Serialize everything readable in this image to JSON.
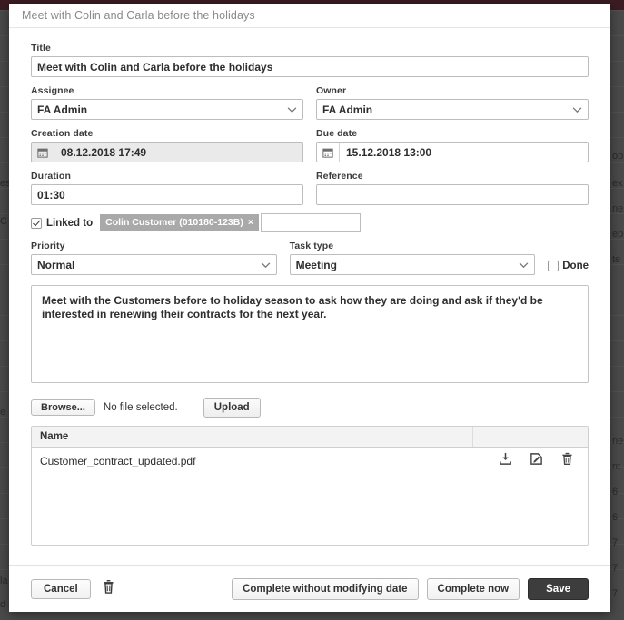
{
  "window": {
    "title": "Meet with Colin and Carla before the holidays"
  },
  "form": {
    "title_label": "Title",
    "title_value": "Meet with Colin and Carla before the holidays",
    "assignee_label": "Assignee",
    "assignee_value": "FA Admin",
    "owner_label": "Owner",
    "owner_value": "FA Admin",
    "creation_date_label": "Creation date",
    "creation_date_value": "08.12.2018 17:49",
    "due_date_label": "Due date",
    "due_date_value": "15.12.2018 13:00",
    "duration_label": "Duration",
    "duration_value": "01:30",
    "reference_label": "Reference",
    "reference_value": "",
    "linked_to_label": "Linked to",
    "linked_to_checked": true,
    "linked_token": "Colin Customer (010180-123B)",
    "linked_token_remove": "×",
    "linked_input_value": "",
    "priority_label": "Priority",
    "priority_value": "Normal",
    "task_type_label": "Task type",
    "task_type_value": "Meeting",
    "done_label": "Done",
    "done_checked": false,
    "description_value": "Meet with the Customers before to holiday season to ask how they are doing and ask if they'd be interested in renewing their contracts for the next year."
  },
  "attachments": {
    "browse_label": "Browse...",
    "no_file_text": "No file selected.",
    "upload_label": "Upload",
    "column_name": "Name",
    "rows": [
      {
        "name": "Customer_contract_updated.pdf",
        "download_icon": "download-icon",
        "edit_icon": "edit-icon",
        "delete_icon": "trash-icon"
      }
    ]
  },
  "footer": {
    "cancel_label": "Cancel",
    "delete_icon": "trash-icon",
    "complete_without_date_label": "Complete without modifying date",
    "complete_now_label": "Complete now",
    "save_label": "Save"
  },
  "colors": {
    "topbar": "#3b1c22",
    "overlay": "#4a4a4a",
    "save_bg": "#3d3d3d",
    "token_bg": "#a9a9a9",
    "title_text": "#8a8a8a"
  },
  "background_hints": {
    "fragments": [
      "op",
      "ex",
      "ne",
      "ep",
      "te",
      "ne",
      "nt",
      "6",
      "6",
      "7",
      "7",
      "7",
      "e",
      "es",
      "C",
      "la",
      "d",
      "7",
      "o"
    ]
  }
}
